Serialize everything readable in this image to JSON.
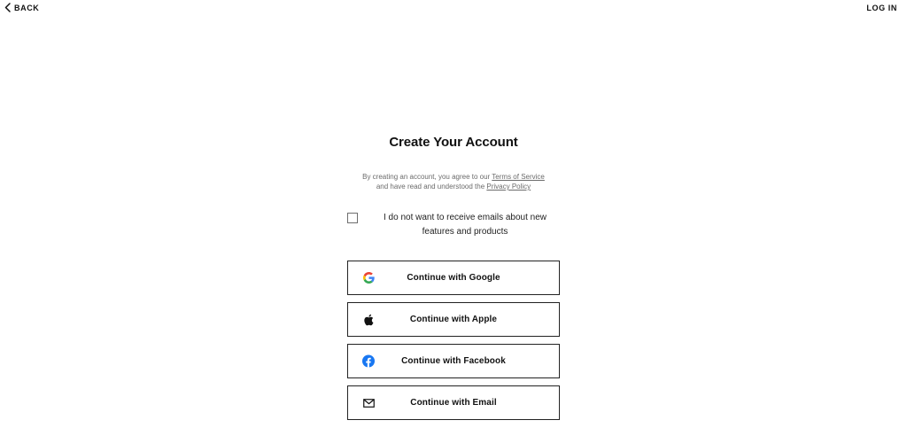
{
  "header": {
    "back_label": "BACK",
    "login_label": "LOG IN"
  },
  "main": {
    "title": "Create Your Account",
    "terms_line1_prefix": "By creating an account, you agree to our ",
    "terms_link": "Terms of Service",
    "terms_line2_prefix": "and have read and understood the ",
    "privacy_link": "Privacy Policy",
    "optout_label": "I do not want to receive emails about new features and products",
    "optout_checked": false
  },
  "buttons": {
    "google": "Continue with Google",
    "apple": "Continue with Apple",
    "facebook": "Continue with Facebook",
    "email": "Continue with Email"
  },
  "icons": {
    "back": "chevron-left-icon",
    "google": "google-icon",
    "apple": "apple-icon",
    "facebook": "facebook-icon",
    "email": "envelope-icon"
  },
  "colors": {
    "facebook_blue": "#1877F2",
    "google_blue": "#4285F4",
    "google_red": "#EA4335",
    "google_yellow": "#FBBC05",
    "google_green": "#34A853"
  }
}
